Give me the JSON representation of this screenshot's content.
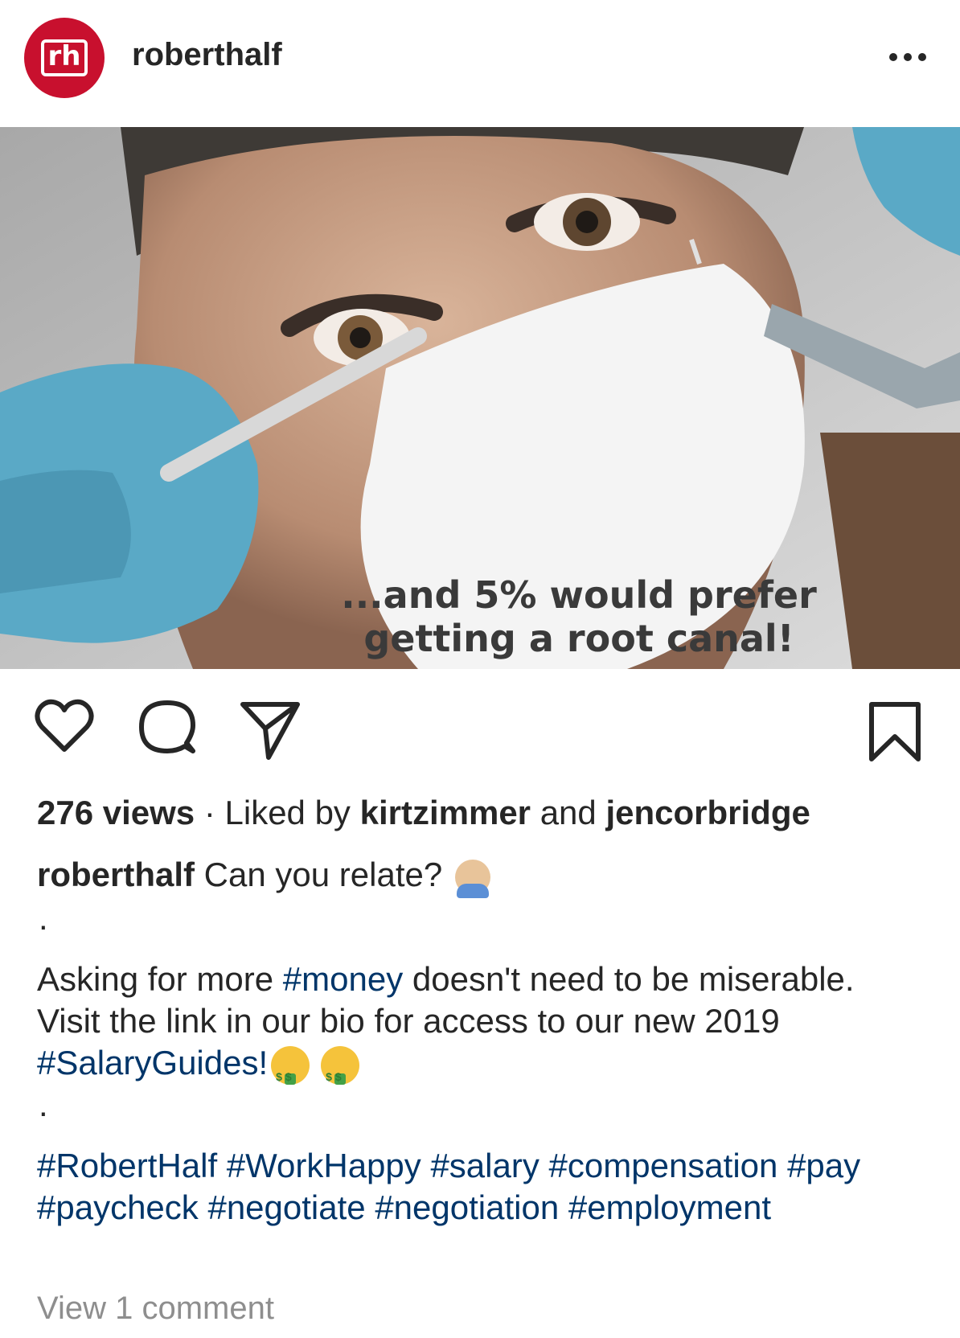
{
  "post": {
    "username": "roberthalf",
    "avatar_text": "rh",
    "image_overlay_line1": "...and 5% would prefer",
    "image_overlay_line2": "getting a root canal!",
    "views": "276 views",
    "separator": " · ",
    "liked_by_prefix": "Liked by ",
    "liked_user_1": "kirtzimmer",
    "liked_and": " and ",
    "liked_user_2": "jencorbridge",
    "caption_user": "roberthalf",
    "caption_text": " Can you relate? ",
    "dot": ".",
    "body_part1": "Asking for more ",
    "body_tag_money": "#money",
    "body_part2": " doesn't need to be miserable. Visit the link in our bio for access to our new 2019 ",
    "body_tag_salaryguides": "#SalaryGuides",
    "body_part3": "!",
    "hashtags": [
      "#RobertHalf",
      "#WorkHappy",
      "#salary",
      "#compensation",
      "#pay",
      "#paycheck",
      "#negotiate",
      "#negotiation",
      "#employment"
    ],
    "view_comments": "View 1 comment"
  },
  "icons": {
    "more": "more-options-icon",
    "like": "heart-icon",
    "comment": "comment-bubble-icon",
    "share": "paper-plane-icon",
    "save": "bookmark-icon"
  },
  "colors": {
    "brand_red": "#c8102e",
    "hashtag_blue": "#003569",
    "text": "#262626",
    "muted": "#8e8e8e"
  }
}
